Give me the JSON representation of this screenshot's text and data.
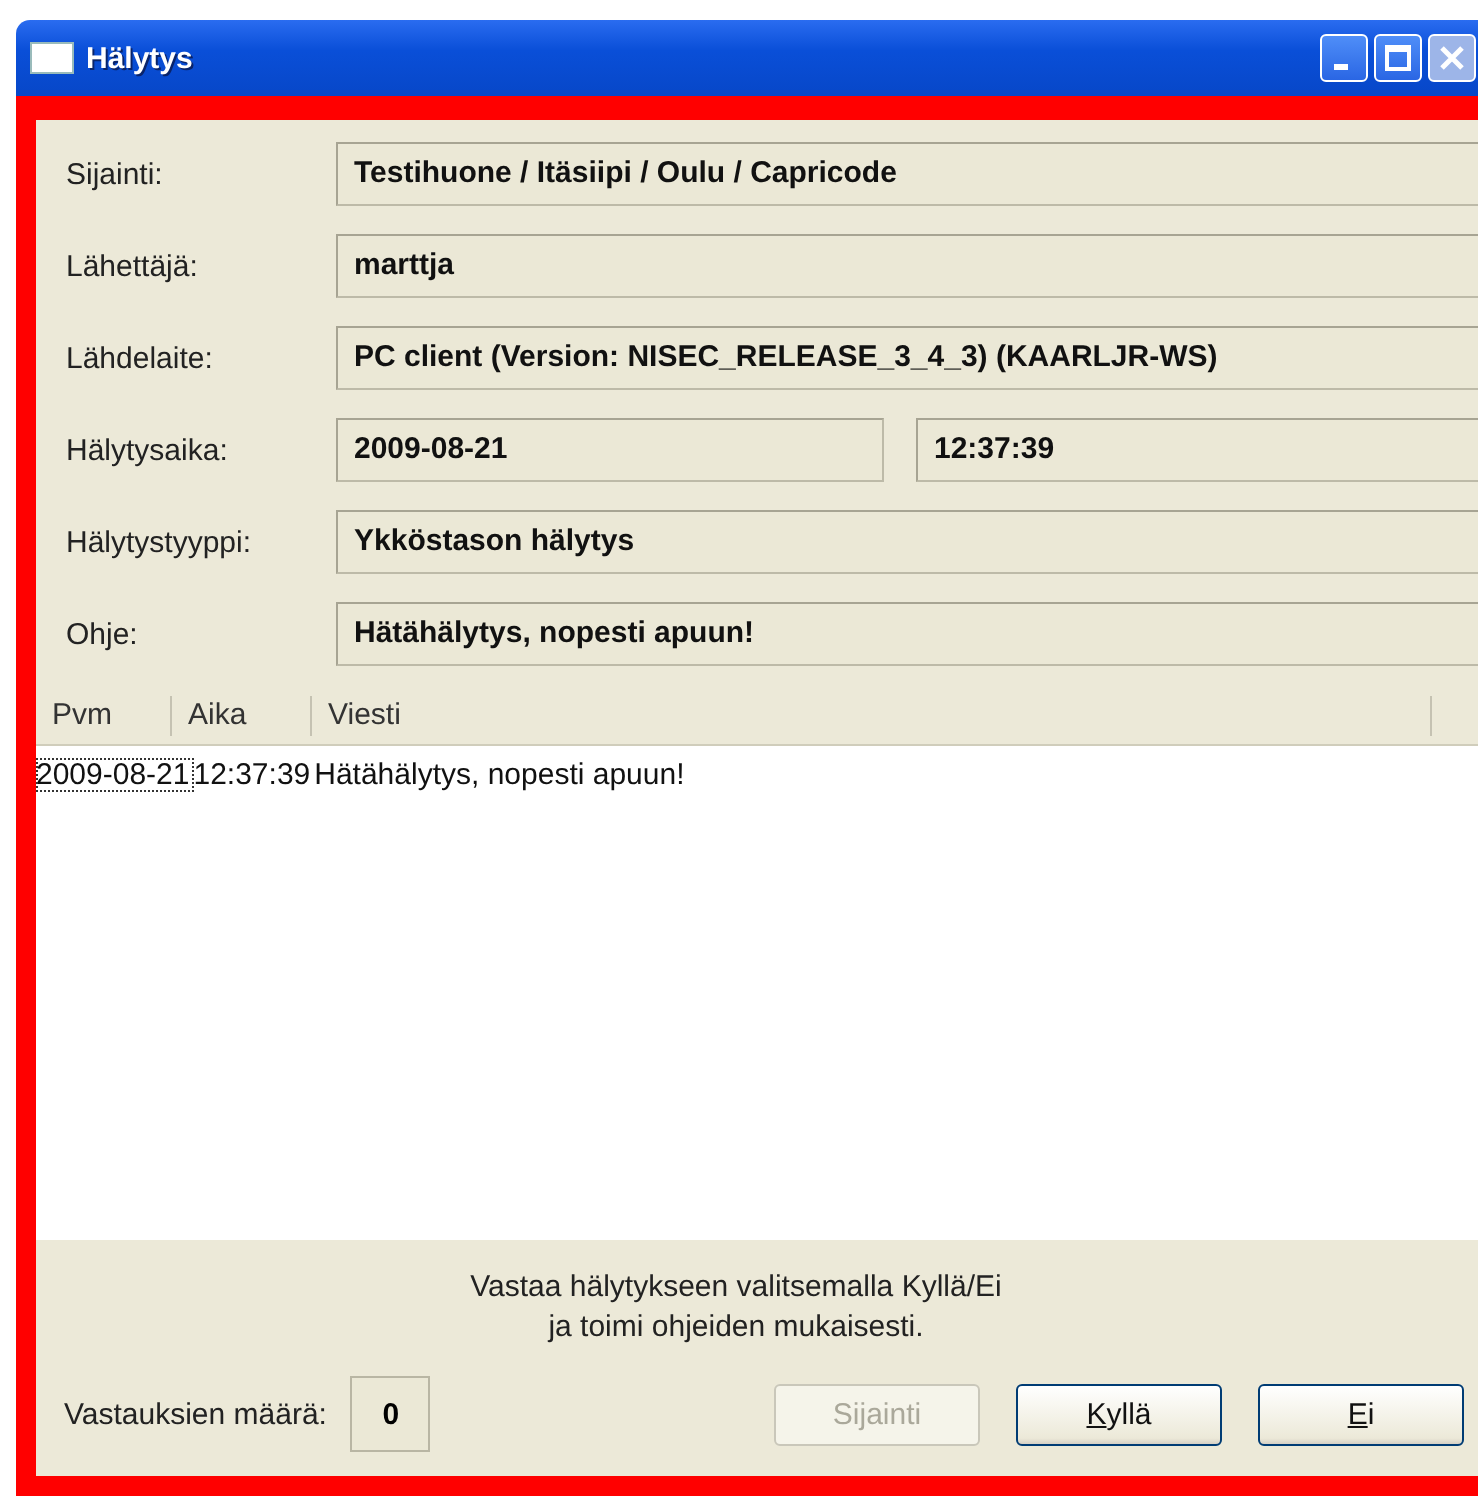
{
  "window": {
    "title": "Hälytys"
  },
  "fields": [
    {
      "label": "Sijainti:",
      "values": [
        "Testihuone / Itäsiipi / Oulu / Capricode"
      ]
    },
    {
      "label": "Lähettäjä:",
      "values": [
        "marttja"
      ]
    },
    {
      "label": "Lähdelaite:",
      "values": [
        "PC client (Version: NISEC_RELEASE_3_4_3) (KAARLJR-WS)"
      ]
    },
    {
      "label": "Hälytysaika:",
      "values": [
        "2009-08-21",
        "12:37:39"
      ]
    },
    {
      "label": "Hälytystyyppi:",
      "values": [
        "Ykköstason hälytys"
      ]
    },
    {
      "label": "Ohje:",
      "values": [
        "Hätähälytys, nopesti apuun!"
      ]
    }
  ],
  "table": {
    "columns": [
      "Pvm",
      "Aika",
      "Viesti"
    ],
    "rows": [
      {
        "cells": [
          "2009-08-21",
          "12:37:39",
          "Hätähälytys, nopesti apuun!"
        ],
        "focused": true
      }
    ]
  },
  "instructions": [
    "Vastaa hälytykseen valitsemalla Kyllä/Ei",
    "ja toimi ohjeiden mukaisesti."
  ],
  "response_count": {
    "label": "Vastauksien määrä:",
    "value": "0"
  },
  "buttons": [
    {
      "label": "Sijainti",
      "disabled": true
    },
    {
      "label": "Kyllä",
      "disabled": false,
      "access_key_underlined": true
    },
    {
      "label": "Ei",
      "disabled": false,
      "access_key_underlined": true
    }
  ]
}
